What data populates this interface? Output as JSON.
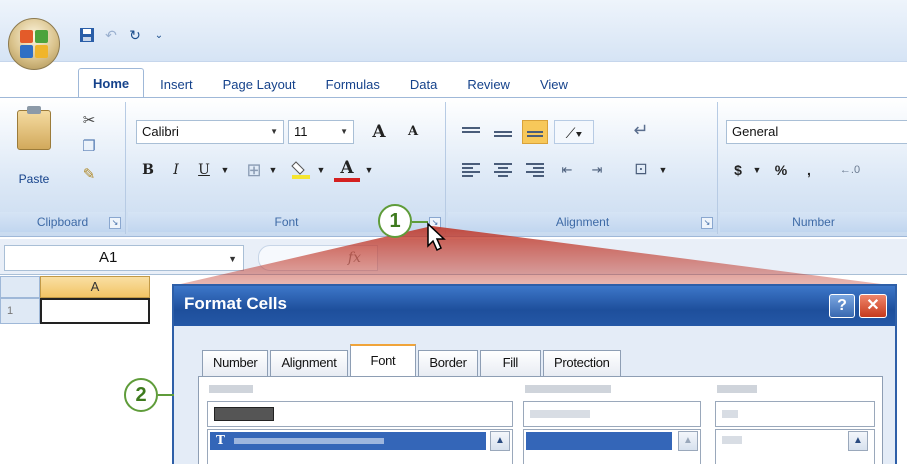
{
  "quick_access": {
    "save_icon": "save-icon",
    "undo_icon": "undo-icon",
    "redo_icon": "redo-icon"
  },
  "tabs": [
    "Home",
    "Insert",
    "Page Layout",
    "Formulas",
    "Data",
    "Review",
    "View"
  ],
  "active_tab": "Home",
  "ribbon": {
    "clipboard": {
      "paste_label": "Paste",
      "group_label": "Clipboard"
    },
    "font": {
      "font_name": "Calibri",
      "font_size": "11",
      "grow_label": "A",
      "shrink_label": "A",
      "bold": "B",
      "italic": "I",
      "underline": "U",
      "font_color_label": "A",
      "group_label": "Font"
    },
    "alignment": {
      "group_label": "Alignment"
    },
    "number": {
      "format": "General",
      "currency": "$",
      "percent": "%",
      "comma": ",",
      "group_label": "Number"
    }
  },
  "formula_bar": {
    "name_box": "A1",
    "fx_label": "fx"
  },
  "grid": {
    "column_a": "A",
    "row_1": "1"
  },
  "callouts": {
    "one": "1",
    "two": "2"
  },
  "dialog": {
    "title": "Format Cells",
    "help_label": "?",
    "close_label": "✕",
    "tabs": [
      "Number",
      "Alignment",
      "Font",
      "Border",
      "Fill",
      "Protection"
    ],
    "active_tab": "Font"
  },
  "colors": {
    "ribbon_blue": "#15428b",
    "dialog_title": "#1e4f9c",
    "callout_green": "#5f9c3a",
    "highlight": "#3466b8",
    "beam_red": "#c0392b"
  }
}
